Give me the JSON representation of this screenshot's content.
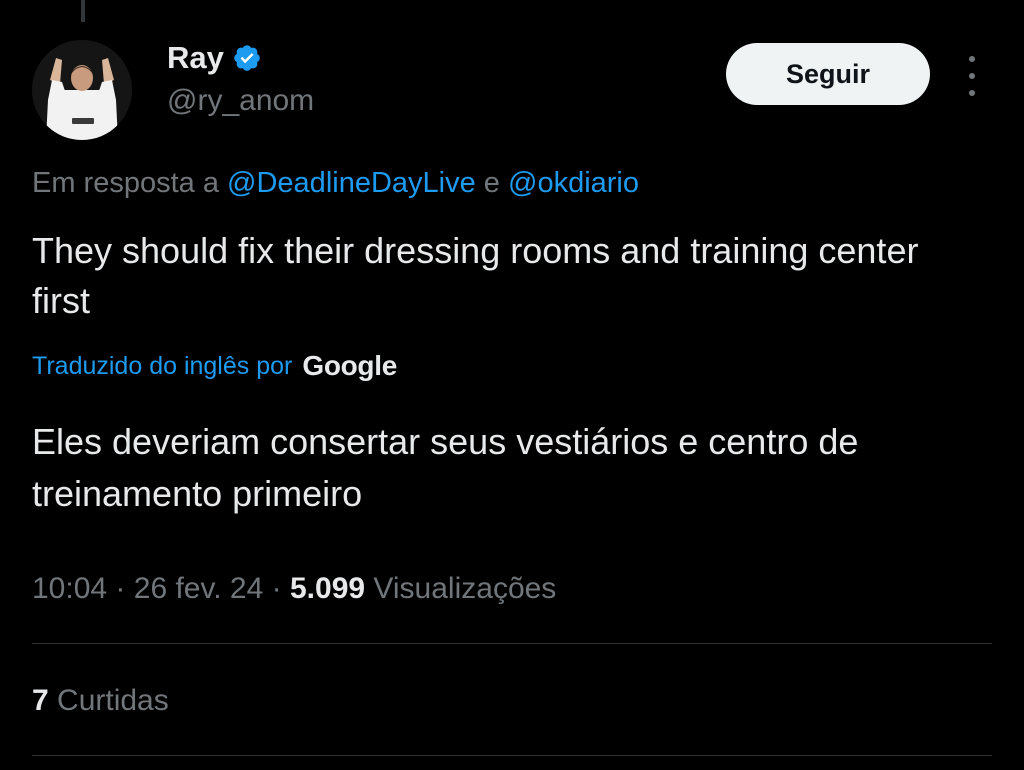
{
  "author": {
    "display_name": "Ray",
    "handle": "@ry_anom",
    "verified": true
  },
  "follow_button": {
    "label": "Seguir"
  },
  "reply": {
    "prefix": "Em resposta a",
    "mention_1": "@DeadlineDayLive",
    "conjunction": "e",
    "mention_2": "@okdiario"
  },
  "tweet": {
    "text": "They should fix their dressing rooms and training center first"
  },
  "translation": {
    "label": "Traduzido do inglês por",
    "provider": "Google",
    "text": "Eles deveriam consertar seus vestiários e centro de treinamento primeiro"
  },
  "meta": {
    "time": "10:04",
    "date": "26 fev. 24",
    "separator": "·",
    "views_count": "5.099",
    "views_label": "Visualizações"
  },
  "engagement": {
    "likes_count": "7",
    "likes_label": "Curtidas"
  },
  "colors": {
    "background": "#000000",
    "text_primary": "#e7e9ea",
    "text_secondary": "#71767b",
    "accent": "#1d9bf0",
    "follow_bg": "#eff3f4"
  },
  "icons": [
    "verified-badge-icon",
    "more-options-icon"
  ]
}
